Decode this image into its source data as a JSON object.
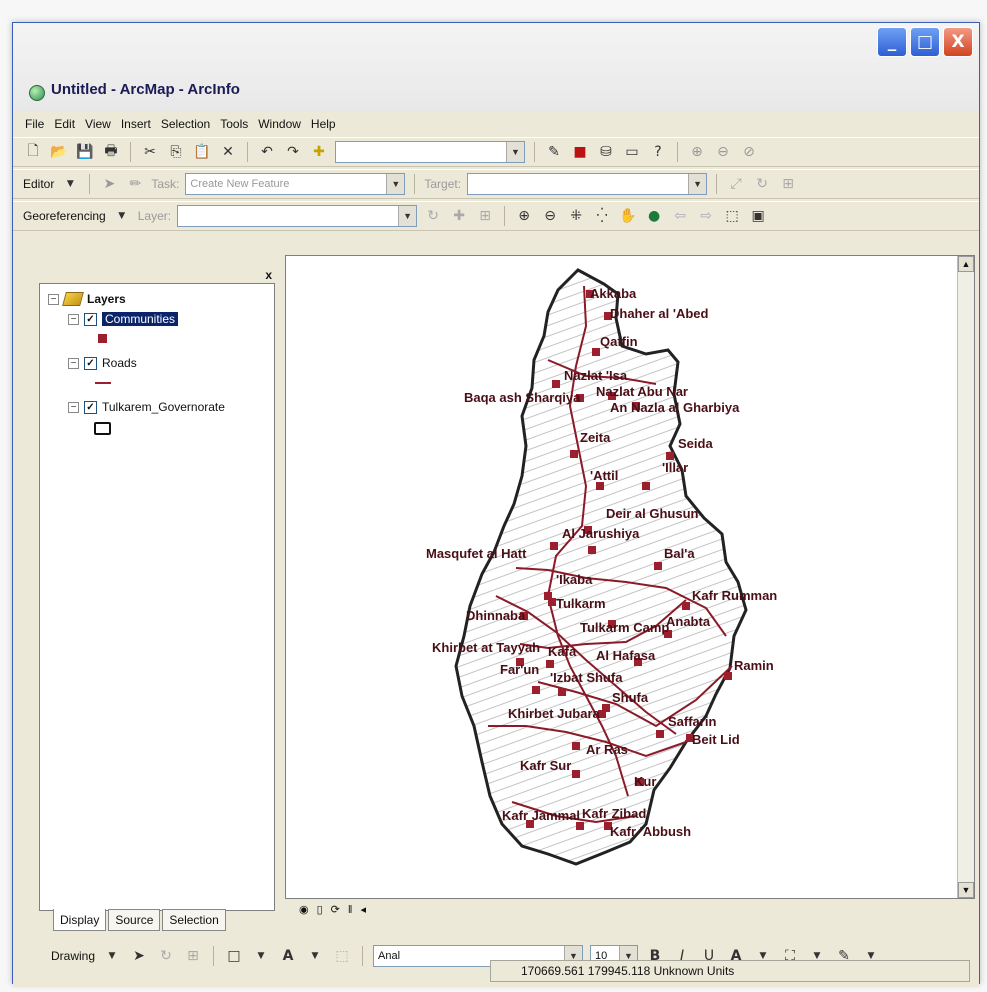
{
  "window": {
    "title": "Untitled - ArcMap - ArcInfo"
  },
  "window_buttons": {
    "minimize": "_",
    "maximize": "□",
    "close": "X"
  },
  "menu": [
    "File",
    "Edit",
    "View",
    "Insert",
    "Selection",
    "Tools",
    "Window",
    "Help"
  ],
  "toolbar_editor": {
    "editor_label": "Editor",
    "task_label": "Task:",
    "task_value": "Create New Feature",
    "target_label": "Target:"
  },
  "toolbar_georef": {
    "label": "Georeferencing",
    "layer_label": "Layer:"
  },
  "toc": {
    "root": "Layers",
    "layers": [
      {
        "name": "Communities",
        "selected": true
      },
      {
        "name": "Roads"
      },
      {
        "name": "Tulkarem_Governorate"
      }
    ],
    "close": "x"
  },
  "tabs": [
    "Display",
    "Source",
    "Selection"
  ],
  "drawing": {
    "label": "Drawing",
    "font": "Anal",
    "size": "10",
    "bold": "B",
    "italic": "I",
    "underline": "U",
    "text_tool": "A"
  },
  "status": {
    "coordinates": "170669.561  179945.118 Unknown Units"
  },
  "map": {
    "communities": [
      "Akkaba",
      "Dhaher al 'Abed",
      "Qaffin",
      "Nazlat 'Isa",
      "Baqa ash Sharqiya",
      "Nazlat Abu Nar",
      "An Nazla al Gharbiya",
      "Zeita",
      "Seida",
      "'Illar",
      "'Attil",
      "Deir al Ghusun",
      "Al Jarushiya",
      "Masqufet al Hatt",
      "Bal'a",
      "'Ikaba",
      "Kafr Rumman",
      "Tulkarm",
      "Anabta",
      "Dhinnaba",
      "Tulkarm Camp",
      "Khirbet at Tayyah",
      "Kafa",
      "Al Hafasa",
      "Ramin",
      "Far'un",
      "'Izbat Shufa",
      "Shufa",
      "Khirbet Jubara",
      "Saffarin",
      "Beit Lid",
      "Ar Ras",
      "Kafr Sur",
      "Kur",
      "Kafr Jammal",
      "Kafr Zibad",
      "Kafr 'Abbush"
    ]
  }
}
